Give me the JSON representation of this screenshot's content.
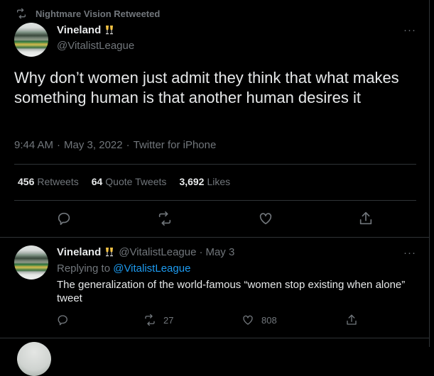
{
  "retweet_context": {
    "label": "Nightmare Vision Retweeted"
  },
  "main_tweet": {
    "display_name": "Vineland",
    "handle": "@VitalistLeague",
    "more": "···",
    "text": "Why don’t women just admit they think that what makes something human is that another human desires it",
    "time": "9:44 AM",
    "date": "May 3, 2022",
    "source": "Twitter for iPhone",
    "sep": "·",
    "stats": {
      "retweets_count": "456",
      "retweets_label": "Retweets",
      "quotes_count": "64",
      "quotes_label": "Quote Tweets",
      "likes_count": "3,692",
      "likes_label": "Likes"
    }
  },
  "reply_tweet": {
    "display_name": "Vineland",
    "handle": "@VitalistLeague",
    "sep": "·",
    "date": "May 3",
    "more": "···",
    "replying_prefix": "Replying to",
    "replying_handle": "@VitalistLeague",
    "text": "The generalization of the world-famous “women stop existing when alone” tweet",
    "retweets": "27",
    "likes": "808"
  },
  "colors": {
    "background": "#000000",
    "text": "#e7e9ea",
    "muted": "#71767b",
    "link": "#1d9bf0",
    "divider": "#2f3336"
  },
  "icons": [
    "retweet-icon",
    "champagne-emoji-icon",
    "more-icon",
    "reply-icon",
    "heart-icon",
    "share-icon"
  ]
}
